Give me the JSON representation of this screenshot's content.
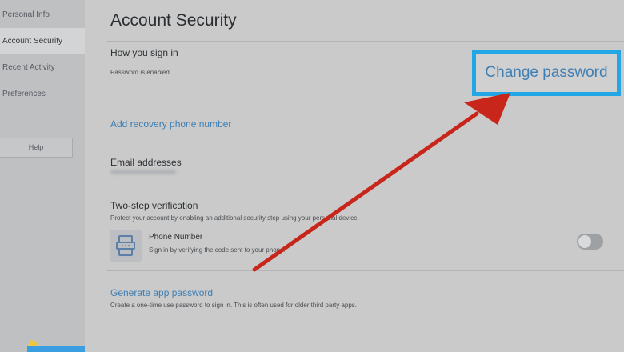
{
  "sidebar": {
    "items": [
      {
        "label": "Personal Info"
      },
      {
        "label": "Account Security"
      },
      {
        "label": "Recent Activity"
      },
      {
        "label": "Preferences"
      }
    ],
    "help_label": "Help"
  },
  "main": {
    "title": "Account Security",
    "signin": {
      "title": "How you sign in",
      "status": "Password is enabled.",
      "change_label": "Change password"
    },
    "recovery": {
      "link": "Add recovery phone number"
    },
    "email": {
      "title": "Email addresses"
    },
    "two_step": {
      "title": "Two-step verification",
      "desc": "Protect your account by enabling an additional security step using your personal device.",
      "phone_title": "Phone Number",
      "phone_desc": "Sign in by verifying the code sent to your phone.",
      "toggle_on": false
    },
    "app_password": {
      "link": "Generate app password",
      "desc": "Create a one-time use password to sign in. This is often used for older third party apps."
    }
  },
  "colors": {
    "accent": "#23a6e6",
    "link": "#3f7fb3",
    "arrow": "#c8261a"
  },
  "icons": {
    "phone": "phone-icon",
    "toggle": "toggle-switch-icon"
  }
}
